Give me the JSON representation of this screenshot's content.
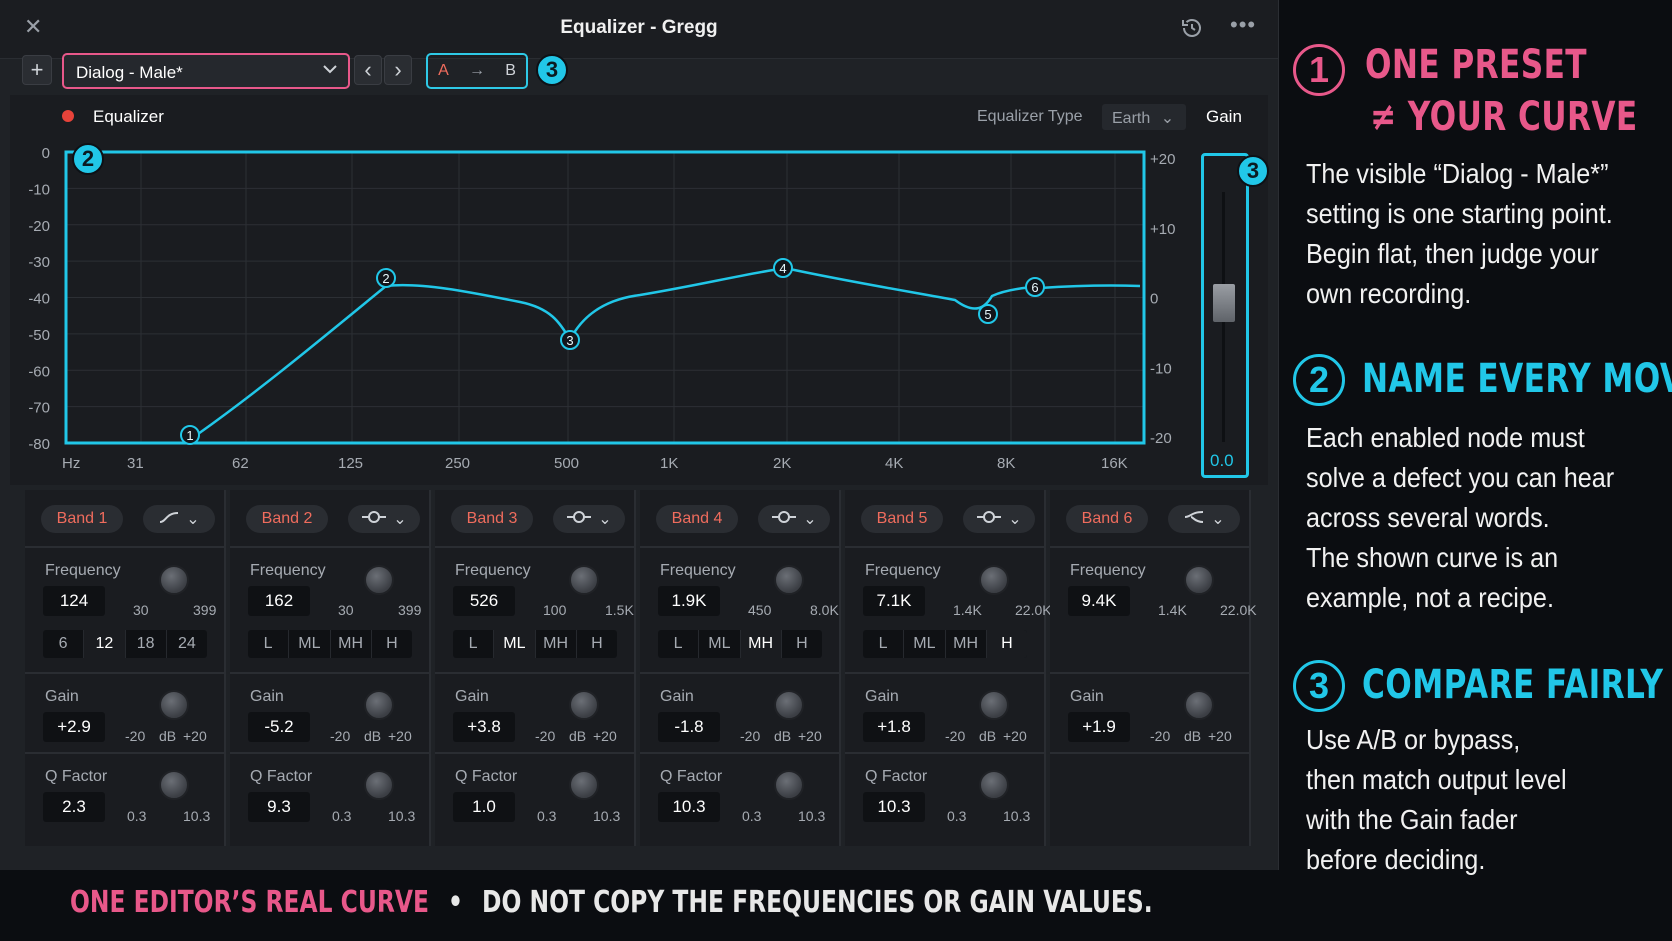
{
  "window": {
    "title": "Equalizer - Gregg"
  },
  "toolbar": {
    "add": "+",
    "preset": "Dialog - Male*",
    "prev": "‹",
    "next": "›",
    "a": "A",
    "arrow": "→",
    "b": "B",
    "callout3": "3"
  },
  "eq_header": {
    "label": "Equalizer",
    "type_label": "Equalizer Type",
    "type_value": "Earth",
    "gain_label": "Gain",
    "callout2": "2",
    "callout3": "3"
  },
  "graph": {
    "y_left": [
      "0",
      "-10",
      "-20",
      "-30",
      "-40",
      "-50",
      "-60",
      "-70",
      "-80"
    ],
    "y_right": [
      "+20",
      "+10",
      "0",
      "-10",
      "-20"
    ],
    "x_labels": [
      "Hz",
      "31",
      "62",
      "125",
      "250",
      "500",
      "1K",
      "2K",
      "4K",
      "8K",
      "16K"
    ],
    "nodes": [
      "1",
      "2",
      "3",
      "4",
      "5",
      "6"
    ],
    "gain_value": "0.0"
  },
  "colors": {
    "accent": "#21c7e8",
    "pink": "#e8588a",
    "band_label": "#ef6c5d"
  },
  "bands": [
    {
      "name": "Band 1",
      "freq": "124",
      "fmin": "30",
      "fmax": "399",
      "slope": [
        "6",
        "12",
        "18",
        "24"
      ],
      "slope_on": 1,
      "gain": "+2.9",
      "q": "2.3",
      "icon": "high-pass-shape-icon"
    },
    {
      "name": "Band 2",
      "freq": "162",
      "fmin": "30",
      "fmax": "399",
      "slope": [
        "L",
        "ML",
        "MH",
        "H"
      ],
      "slope_on": -1,
      "gain": "-5.2",
      "q": "9.3",
      "icon": "bell-shape-icon"
    },
    {
      "name": "Band 3",
      "freq": "526",
      "fmin": "100",
      "fmax": "1.5K",
      "slope": [
        "L",
        "ML",
        "MH",
        "H"
      ],
      "slope_on": 1,
      "gain": "+3.8",
      "q": "1.0",
      "icon": "bell-shape-icon"
    },
    {
      "name": "Band 4",
      "freq": "1.9K",
      "fmin": "450",
      "fmax": "8.0K",
      "slope": [
        "L",
        "ML",
        "MH",
        "H"
      ],
      "slope_on": 2,
      "gain": "-1.8",
      "q": "10.3",
      "icon": "bell-shape-icon"
    },
    {
      "name": "Band 5",
      "freq": "7.1K",
      "fmin": "1.4K",
      "fmax": "22.0K",
      "slope": [
        "L",
        "ML",
        "MH",
        "H"
      ],
      "slope_on": 3,
      "gain": "+1.8",
      "q": "10.3",
      "icon": "bell-shape-icon"
    },
    {
      "name": "Band 6",
      "freq": "9.4K",
      "fmin": "1.4K",
      "fmax": "22.0K",
      "slope": [],
      "slope_on": -1,
      "gain": "+1.9",
      "q": "",
      "icon": "shelf-shape-icon"
    }
  ],
  "labels": {
    "frequency": "Frequency",
    "gain": "Gain",
    "q": "Q Factor",
    "gain_min": "-20",
    "gain_unit": "dB",
    "gain_max": "+20",
    "q_min": "0.3",
    "q_max": "10.3"
  },
  "right_panel": [
    {
      "num": "1",
      "head1": "ONE PRESET",
      "head2": "≠ YOUR CURVE",
      "lines": [
        "The visible “Dialog - Male*”",
        "setting is one starting point.",
        "Begin flat, then judge your",
        "own recording."
      ]
    },
    {
      "num": "2",
      "head1": "NAME EVERY MOVE",
      "lines": [
        "Each enabled node must",
        "solve a defect you can hear",
        "across several words.",
        "The shown curve is an",
        "example, not a recipe."
      ]
    },
    {
      "num": "3",
      "head1": "COMPARE FAIRLY",
      "lines": [
        "Use A/B or bypass,",
        "then match output level",
        "with the Gain fader",
        "before deciding."
      ]
    }
  ],
  "footer": {
    "left": "ONE EDITOR’S REAL CURVE",
    "sep": "•",
    "right": "DO NOT COPY THE FREQUENCIES OR GAIN VALUES."
  }
}
